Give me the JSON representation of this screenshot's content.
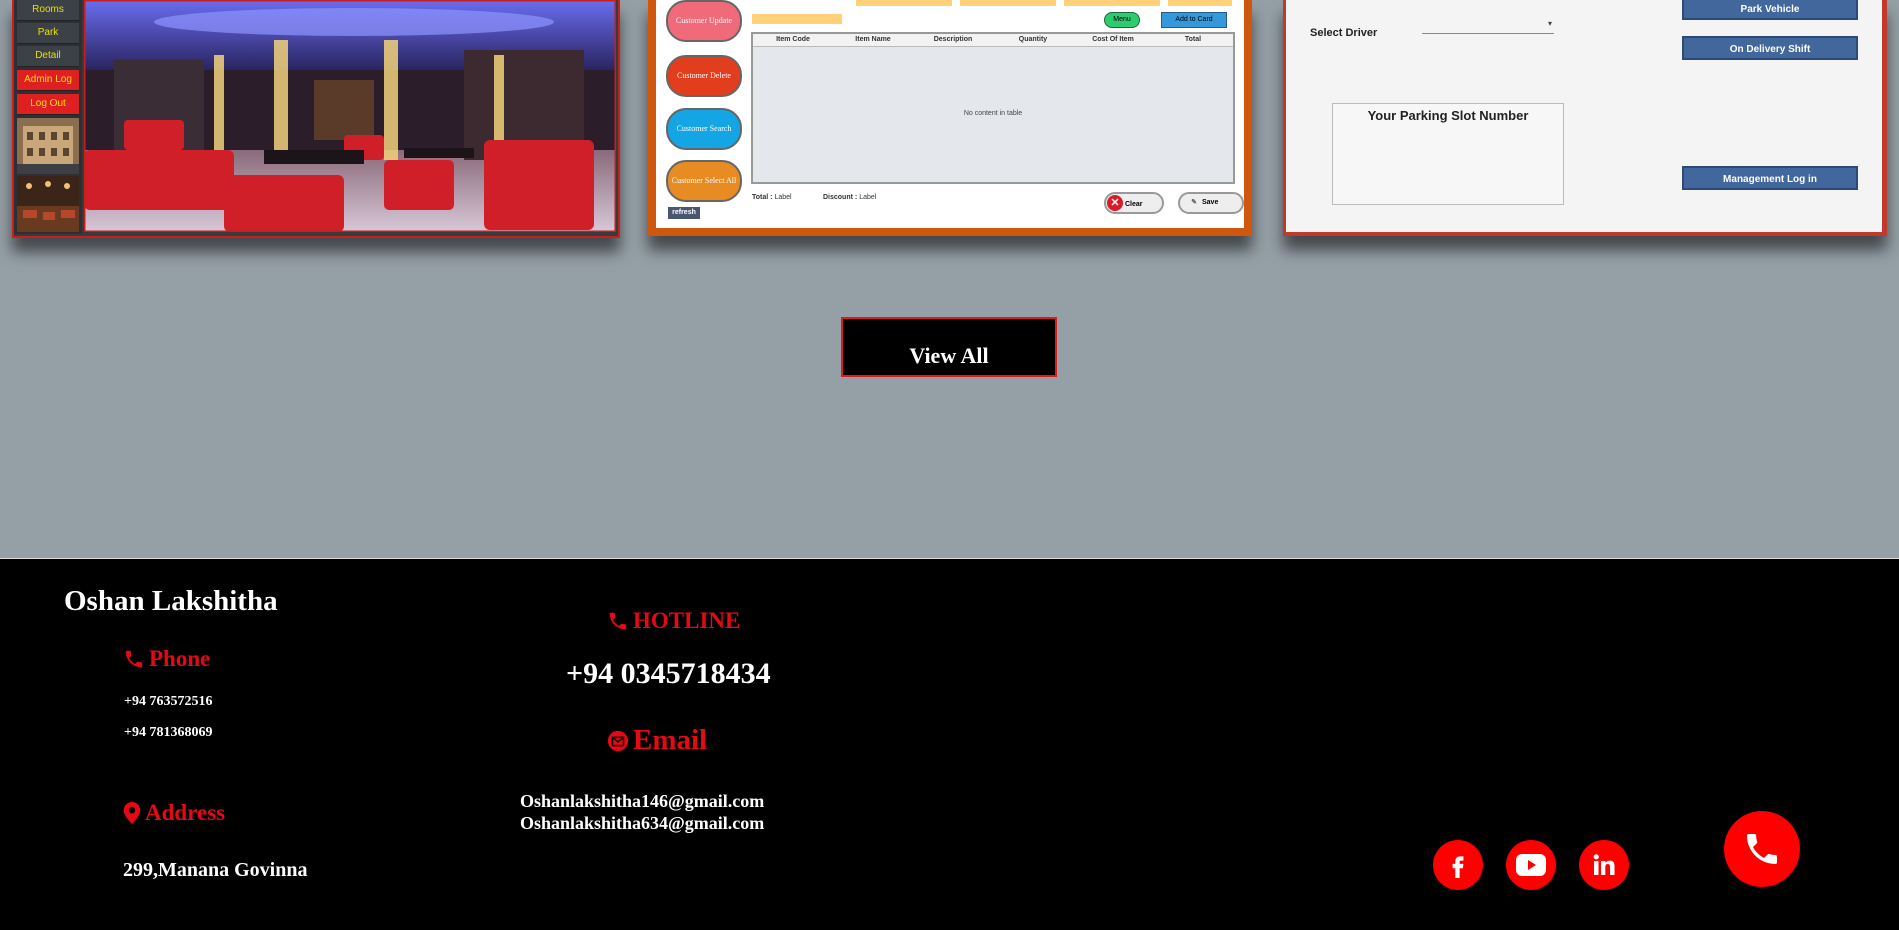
{
  "projects": {
    "card1": {
      "menu": [
        {
          "label": "Rooms",
          "style": "dark"
        },
        {
          "label": "Park",
          "style": "dark"
        },
        {
          "label": "Detail",
          "style": "dark"
        },
        {
          "label": "Admin Log",
          "style": "red"
        },
        {
          "label": "Log Out",
          "style": "red"
        }
      ]
    },
    "card2": {
      "buttons": {
        "update": "Customer Update",
        "delete": "Customer Delete",
        "search": "Customer Search",
        "select_all": "Customer Select All",
        "refresh": "refresh"
      },
      "menu_pill": "Menu",
      "add_to_card": "Add to Card",
      "columns": [
        "Item Code",
        "Item Name",
        "Description",
        "Quantity",
        "Cost Of Item",
        "Total"
      ],
      "empty_text": "No content in table",
      "total_label": "Total :",
      "total_value": "Label",
      "discount_label": "Discount :",
      "discount_value": "Label",
      "clear_label": "Clear",
      "save_label": "Save"
    },
    "card3": {
      "select_driver": "Select Driver",
      "parking_slot_title": "Your Parking Slot Number",
      "park_vehicle": "Park Vehicle",
      "on_delivery_shift": "On Delivery Shift",
      "management_login": "Management Log in"
    }
  },
  "view_all": "View All",
  "footer": {
    "name": "Oshan Lakshitha",
    "phone_heading": "Phone",
    "phones": [
      "+94 763572516",
      "+94 781368069"
    ],
    "address_heading": "Address",
    "address": "299,Manana Govinna",
    "hotline_heading": "HOTLINE",
    "hotline_number": "+94 0345718434",
    "email_heading": "Email",
    "emails": [
      "Oshanlakshitha146@gmail.com",
      "Oshanlakshitha634@gmail.com"
    ],
    "social": [
      "facebook-icon",
      "youtube-icon",
      "linkedin-icon"
    ]
  },
  "colors": {
    "accent": "#e50914",
    "page_bg": "#949fa6",
    "footer_bg": "#000000"
  }
}
